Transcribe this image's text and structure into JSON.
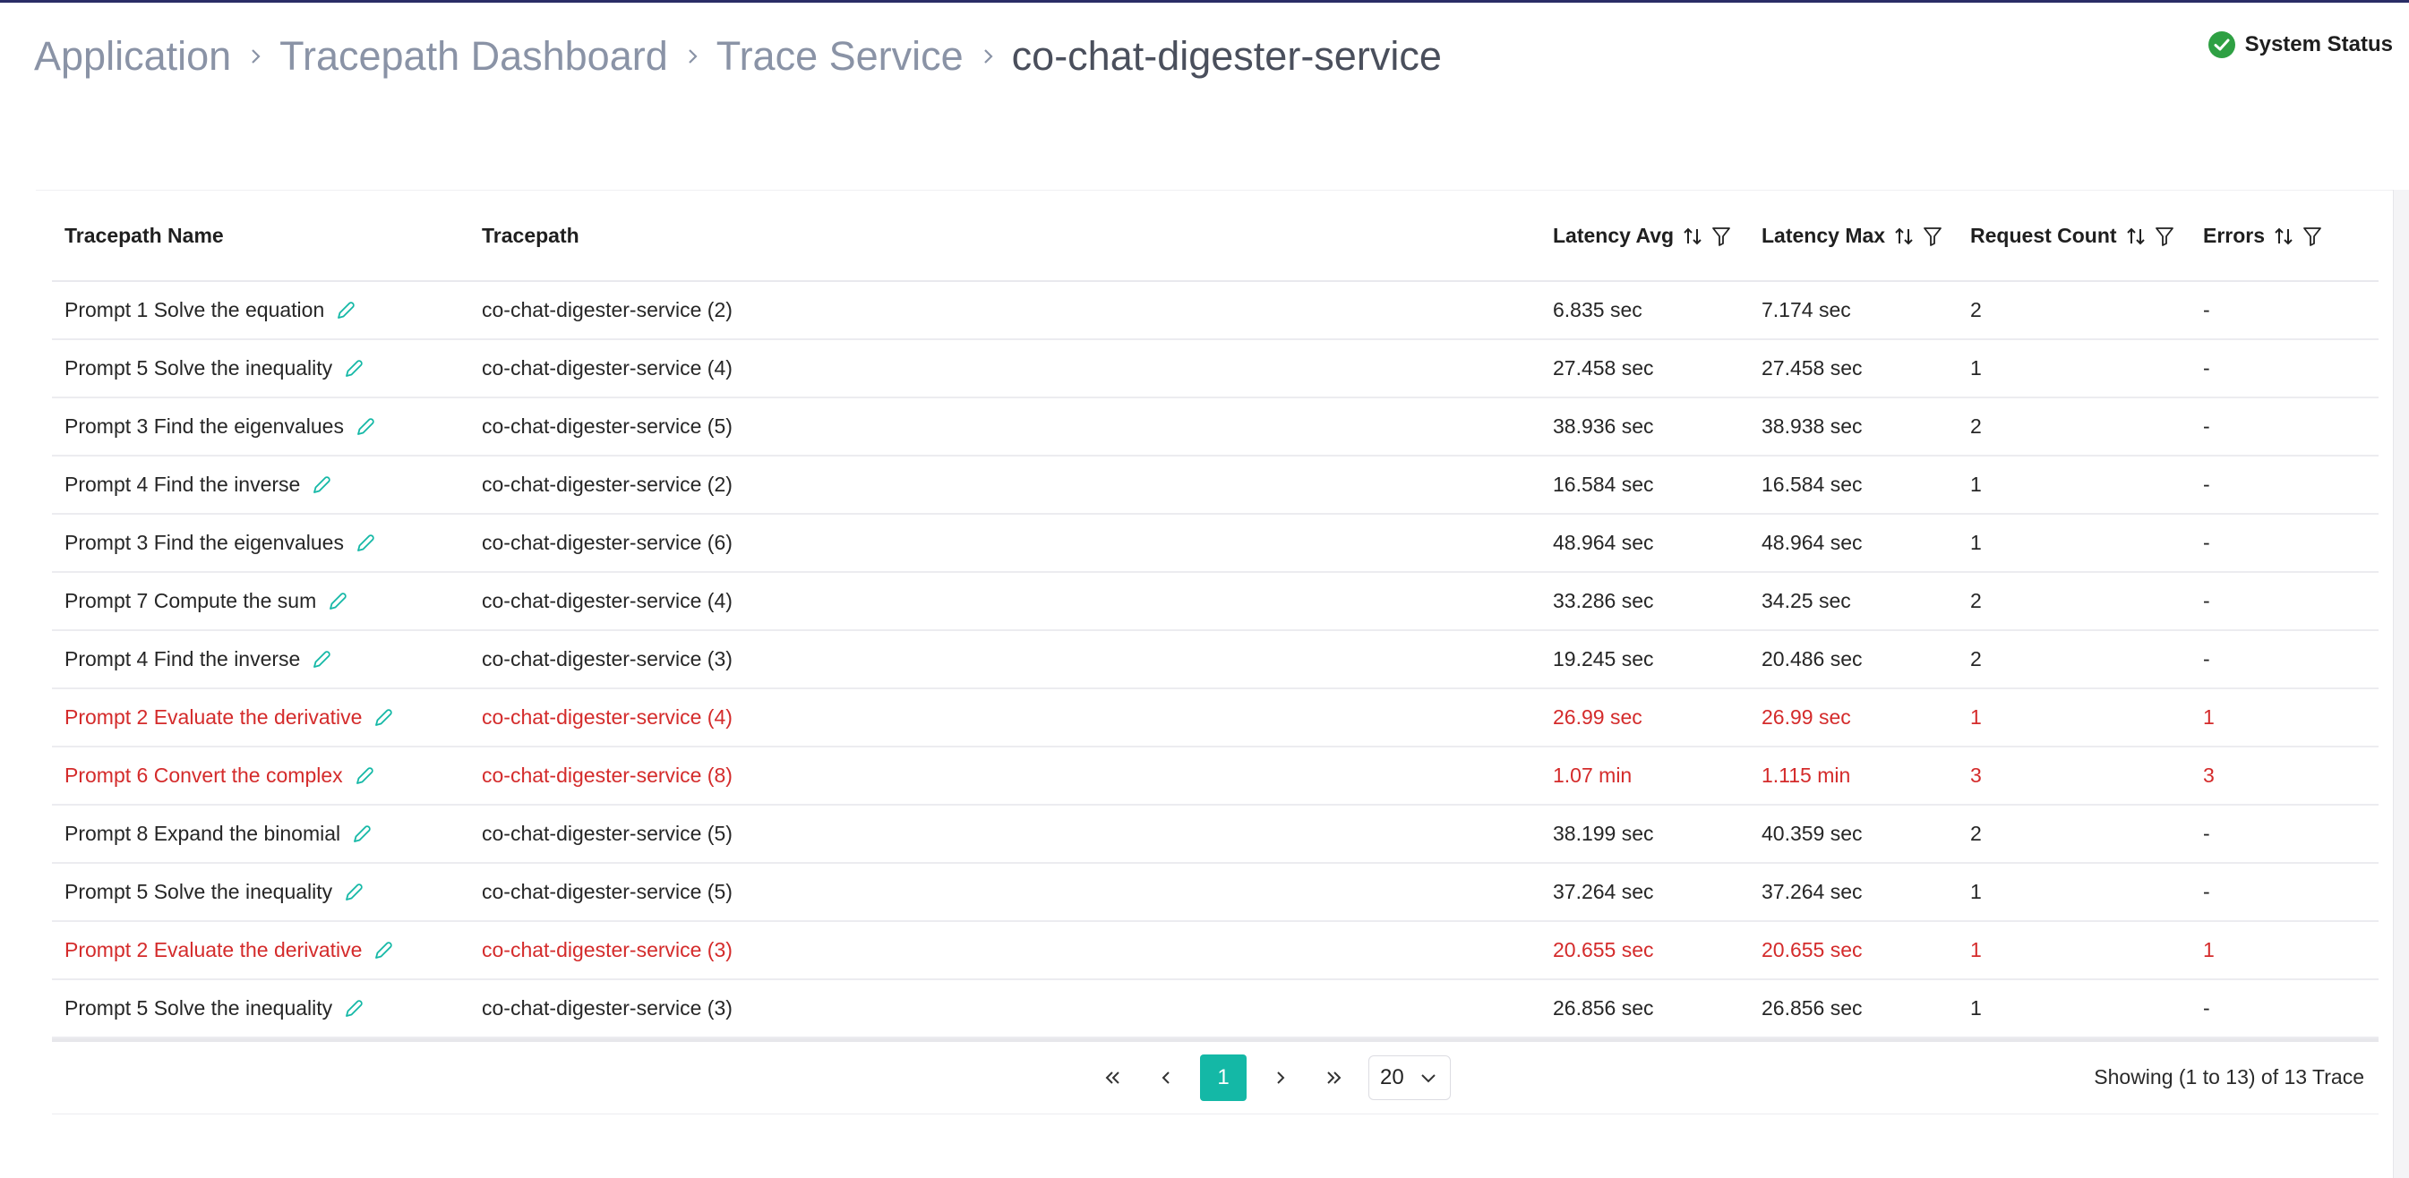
{
  "breadcrumb": {
    "items": [
      "Application",
      "Tracepath Dashboard",
      "Trace Service",
      "co-chat-digester-service"
    ]
  },
  "status": {
    "label": "System Status",
    "icon": "check-circle-icon",
    "color": "#2ea043"
  },
  "table": {
    "headers": {
      "name": "Tracepath Name",
      "tracepath": "Tracepath",
      "latency_avg": "Latency Avg",
      "latency_max": "Latency Max",
      "request_count": "Request Count",
      "errors": "Errors"
    },
    "rows": [
      {
        "name": "Prompt 1 Solve the equation",
        "tracepath": "co-chat-digester-service (2)",
        "latency_avg": "6.835 sec",
        "latency_max": "7.174 sec",
        "request_count": "2",
        "errors": "-",
        "error": false
      },
      {
        "name": "Prompt 5 Solve the inequality",
        "tracepath": "co-chat-digester-service (4)",
        "latency_avg": "27.458 sec",
        "latency_max": "27.458 sec",
        "request_count": "1",
        "errors": "-",
        "error": false
      },
      {
        "name": "Prompt 3 Find the eigenvalues",
        "tracepath": "co-chat-digester-service (5)",
        "latency_avg": "38.936 sec",
        "latency_max": "38.938 sec",
        "request_count": "2",
        "errors": "-",
        "error": false
      },
      {
        "name": "Prompt 4 Find the inverse",
        "tracepath": "co-chat-digester-service (2)",
        "latency_avg": "16.584 sec",
        "latency_max": "16.584 sec",
        "request_count": "1",
        "errors": "-",
        "error": false
      },
      {
        "name": "Prompt 3 Find the eigenvalues",
        "tracepath": "co-chat-digester-service (6)",
        "latency_avg": "48.964 sec",
        "latency_max": "48.964 sec",
        "request_count": "1",
        "errors": "-",
        "error": false
      },
      {
        "name": "Prompt 7 Compute the sum",
        "tracepath": "co-chat-digester-service (4)",
        "latency_avg": "33.286 sec",
        "latency_max": "34.25 sec",
        "request_count": "2",
        "errors": "-",
        "error": false
      },
      {
        "name": "Prompt 4 Find the inverse",
        "tracepath": "co-chat-digester-service (3)",
        "latency_avg": "19.245 sec",
        "latency_max": "20.486 sec",
        "request_count": "2",
        "errors": "-",
        "error": false
      },
      {
        "name": "Prompt 2 Evaluate the derivative",
        "tracepath": "co-chat-digester-service (4)",
        "latency_avg": "26.99 sec",
        "latency_max": "26.99 sec",
        "request_count": "1",
        "errors": "1",
        "error": true
      },
      {
        "name": "Prompt 6 Convert the complex",
        "tracepath": "co-chat-digester-service (8)",
        "latency_avg": "1.07 min",
        "latency_max": "1.115 min",
        "request_count": "3",
        "errors": "3",
        "error": true
      },
      {
        "name": "Prompt 8 Expand the binomial",
        "tracepath": "co-chat-digester-service (5)",
        "latency_avg": "38.199 sec",
        "latency_max": "40.359 sec",
        "request_count": "2",
        "errors": "-",
        "error": false
      },
      {
        "name": "Prompt 5 Solve the inequality",
        "tracepath": "co-chat-digester-service (5)",
        "latency_avg": "37.264 sec",
        "latency_max": "37.264 sec",
        "request_count": "1",
        "errors": "-",
        "error": false
      },
      {
        "name": "Prompt 2 Evaluate the derivative",
        "tracepath": "co-chat-digester-service (3)",
        "latency_avg": "20.655 sec",
        "latency_max": "20.655 sec",
        "request_count": "1",
        "errors": "1",
        "error": true
      },
      {
        "name": "Prompt 5 Solve the inequality",
        "tracepath": "co-chat-digester-service (3)",
        "latency_avg": "26.856 sec",
        "latency_max": "26.856 sec",
        "request_count": "1",
        "errors": "-",
        "error": false
      }
    ]
  },
  "pagination": {
    "current_page": "1",
    "page_size": "20",
    "summary": "Showing (1 to 13) of 13 Trace",
    "active_color": "#14b8a6"
  },
  "colors": {
    "error_text": "#d42b2b",
    "edit_icon": "#14b8a6"
  }
}
